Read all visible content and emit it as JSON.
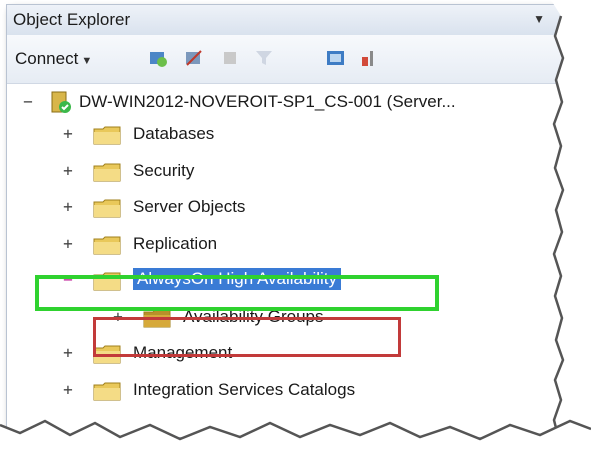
{
  "window": {
    "title": "Object Explorer",
    "title_dropdown": "▼"
  },
  "toolbar": {
    "connect_label": "Connect",
    "connect_caret": "▼",
    "icons": [
      "connect-object-explorer-icon",
      "disconnect-icon",
      "stop-icon",
      "filter-icon",
      "refresh-icon",
      "activity-monitor-icon"
    ]
  },
  "tree": {
    "root": {
      "expander": "−",
      "label": "DW-WIN2012-NOVEROIT-SP1_CS-001 (Server...",
      "icon": "server-icon"
    },
    "nodes": [
      {
        "label": "Databases",
        "expander": "+",
        "icon": "folder-icon"
      },
      {
        "label": "Security",
        "expander": "+",
        "icon": "folder-icon"
      },
      {
        "label": "Server Objects",
        "expander": "+",
        "icon": "folder-icon"
      },
      {
        "label": "Replication",
        "expander": "+",
        "icon": "folder-icon"
      },
      {
        "label": "AlwaysOn High Availability",
        "expander": "−",
        "icon": "folder-icon",
        "selected": true
      },
      {
        "label": "Availability Groups",
        "expander": "+",
        "icon": "folder-icon",
        "child": true
      },
      {
        "label": "Management",
        "expander": "+",
        "icon": "folder-icon"
      },
      {
        "label": "Integration Services Catalogs",
        "expander": "+",
        "icon": "folder-icon"
      }
    ]
  },
  "colors": {
    "highlight_green": "#2fd22f",
    "highlight_red": "#c23a3a",
    "selection_blue": "#3a7bd5"
  }
}
